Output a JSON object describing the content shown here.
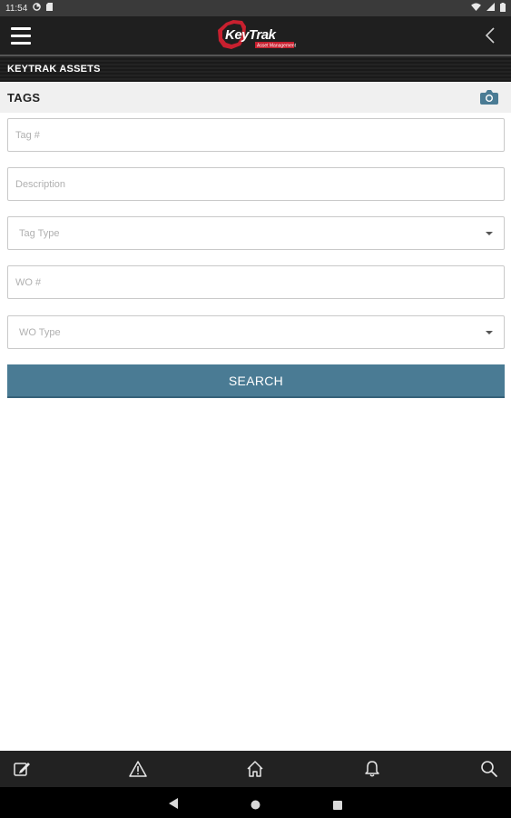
{
  "status_bar": {
    "time": "11:54",
    "left_icons": [
      "data-saver-icon",
      "sd-card-icon"
    ],
    "right_icons": [
      "wifi-icon",
      "signal-icon",
      "battery-icon"
    ]
  },
  "header": {
    "logo_text": "KeyTrak",
    "logo_subtext": "Asset Management",
    "menu_icon": "hamburger-menu-icon",
    "back_icon": "chevron-left-icon"
  },
  "section": {
    "title": "KEYTRAK ASSETS"
  },
  "tags": {
    "title": "TAGS",
    "camera_icon": "camera-icon"
  },
  "form": {
    "tag_number": {
      "placeholder": "Tag #",
      "value": ""
    },
    "description": {
      "placeholder": "Description",
      "value": ""
    },
    "tag_type": {
      "selected": "Tag Type"
    },
    "wo_number": {
      "placeholder": "WO #",
      "value": ""
    },
    "wo_type": {
      "selected": "WO Type"
    },
    "search_label": "SEARCH"
  },
  "bottom_tabs": [
    {
      "icon": "edit-icon"
    },
    {
      "icon": "alert-icon"
    },
    {
      "icon": "home-icon"
    },
    {
      "icon": "bell-icon"
    },
    {
      "icon": "search-icon"
    }
  ],
  "colors": {
    "accent": "#4a7b94",
    "header_bg": "#1f1f1f",
    "logo_red": "#c8202f"
  }
}
